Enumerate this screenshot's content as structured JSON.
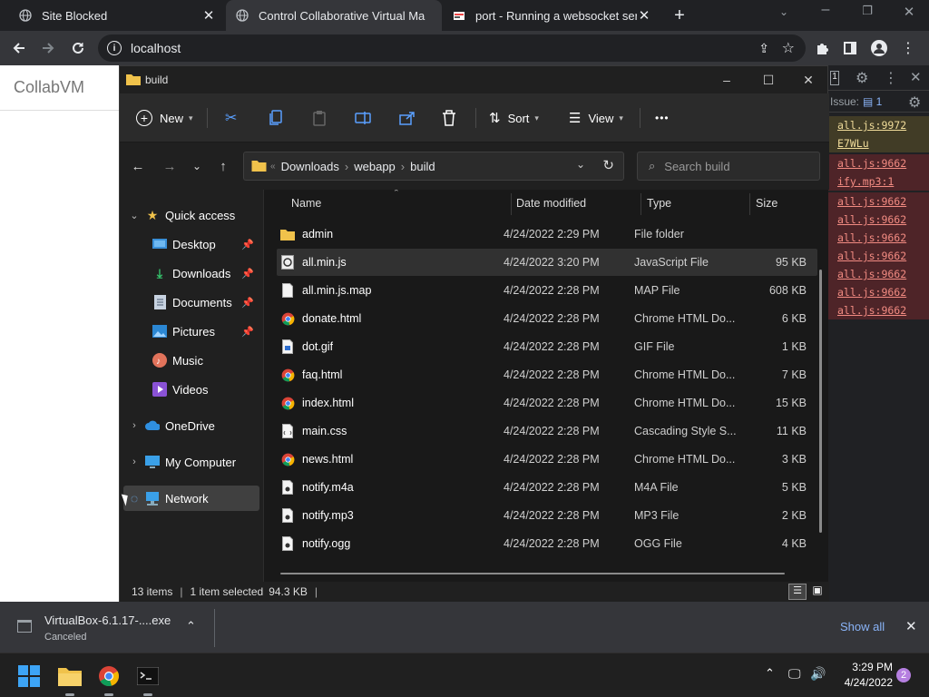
{
  "browser": {
    "tabs": [
      {
        "title": "Site Blocked",
        "favicon": "globe-icon",
        "active": false
      },
      {
        "title": "Control Collaborative Virtual Ma",
        "favicon": "globe-icon",
        "active": true
      },
      {
        "title": "port - Running a websocket serv",
        "favicon": "stackoverflow-icon",
        "active": false
      }
    ],
    "new_tab_label": "+",
    "url": "localhost"
  },
  "page": {
    "site_title": "CollabVM"
  },
  "devtools": {
    "issues_label": "Issue:",
    "issues_count": "1",
    "badge_count": "1",
    "rows": [
      {
        "text": "all.js:9972",
        "kind": "warn"
      },
      {
        "text": "E7WLu",
        "kind": "warn"
      },
      {
        "text": "all.js:9662",
        "kind": "error"
      },
      {
        "text": "ify.mp3:1",
        "kind": "error"
      },
      {
        "text": "all.js:9662",
        "kind": "error"
      },
      {
        "text": "all.js:9662",
        "kind": "error"
      },
      {
        "text": "all.js:9662",
        "kind": "error"
      },
      {
        "text": "all.js:9662",
        "kind": "error"
      },
      {
        "text": "all.js:9662",
        "kind": "error"
      },
      {
        "text": "all.js:9662",
        "kind": "error"
      },
      {
        "text": "all.js:9662",
        "kind": "error"
      }
    ]
  },
  "explorer": {
    "title": "build",
    "toolbar": {
      "new": "New",
      "sort": "Sort",
      "view": "View",
      "more": "•••"
    },
    "breadcrumb": [
      "Downloads",
      "webapp",
      "build"
    ],
    "search_placeholder": "Search build",
    "nav": {
      "quick_access": "Quick access",
      "desktop": "Desktop",
      "downloads": "Downloads",
      "documents": "Documents",
      "pictures": "Pictures",
      "music": "Music",
      "videos": "Videos",
      "onedrive": "OneDrive",
      "my_computer": "My Computer",
      "network": "Network"
    },
    "columns": {
      "name": "Name",
      "date": "Date modified",
      "type": "Type",
      "size": "Size"
    },
    "files": [
      {
        "name": "admin",
        "date": "4/24/2022 2:29 PM",
        "type": "File folder",
        "size": "",
        "icon": "folder-icon"
      },
      {
        "name": "all.min.js",
        "date": "4/24/2022 3:20 PM",
        "type": "JavaScript File",
        "size": "95 KB",
        "icon": "js-file-icon",
        "selected": true
      },
      {
        "name": "all.min.js.map",
        "date": "4/24/2022 2:28 PM",
        "type": "MAP File",
        "size": "608 KB",
        "icon": "file-icon"
      },
      {
        "name": "donate.html",
        "date": "4/24/2022 2:28 PM",
        "type": "Chrome HTML Do...",
        "size": "6 KB",
        "icon": "chrome-icon"
      },
      {
        "name": "dot.gif",
        "date": "4/24/2022 2:28 PM",
        "type": "GIF File",
        "size": "1 KB",
        "icon": "image-file-icon"
      },
      {
        "name": "faq.html",
        "date": "4/24/2022 2:28 PM",
        "type": "Chrome HTML Do...",
        "size": "7 KB",
        "icon": "chrome-icon"
      },
      {
        "name": "index.html",
        "date": "4/24/2022 2:28 PM",
        "type": "Chrome HTML Do...",
        "size": "15 KB",
        "icon": "chrome-icon"
      },
      {
        "name": "main.css",
        "date": "4/24/2022 2:28 PM",
        "type": "Cascading Style S...",
        "size": "11 KB",
        "icon": "css-file-icon"
      },
      {
        "name": "news.html",
        "date": "4/24/2022 2:28 PM",
        "type": "Chrome HTML Do...",
        "size": "3 KB",
        "icon": "chrome-icon"
      },
      {
        "name": "notify.m4a",
        "date": "4/24/2022 2:28 PM",
        "type": "M4A File",
        "size": "5 KB",
        "icon": "audio-file-icon"
      },
      {
        "name": "notify.mp3",
        "date": "4/24/2022 2:28 PM",
        "type": "MP3 File",
        "size": "2 KB",
        "icon": "audio-file-icon"
      },
      {
        "name": "notify.ogg",
        "date": "4/24/2022 2:28 PM",
        "type": "OGG File",
        "size": "4 KB",
        "icon": "audio-file-icon"
      }
    ],
    "status": {
      "items": "13 items",
      "selected": "1 item selected",
      "size": "94.3 KB"
    }
  },
  "download_shelf": {
    "file": "VirtualBox-6.1.17-....exe",
    "status": "Canceled",
    "show_all": "Show all"
  },
  "taskbar": {
    "time": "3:29 PM",
    "date": "4/24/2022",
    "notifications": "2"
  }
}
